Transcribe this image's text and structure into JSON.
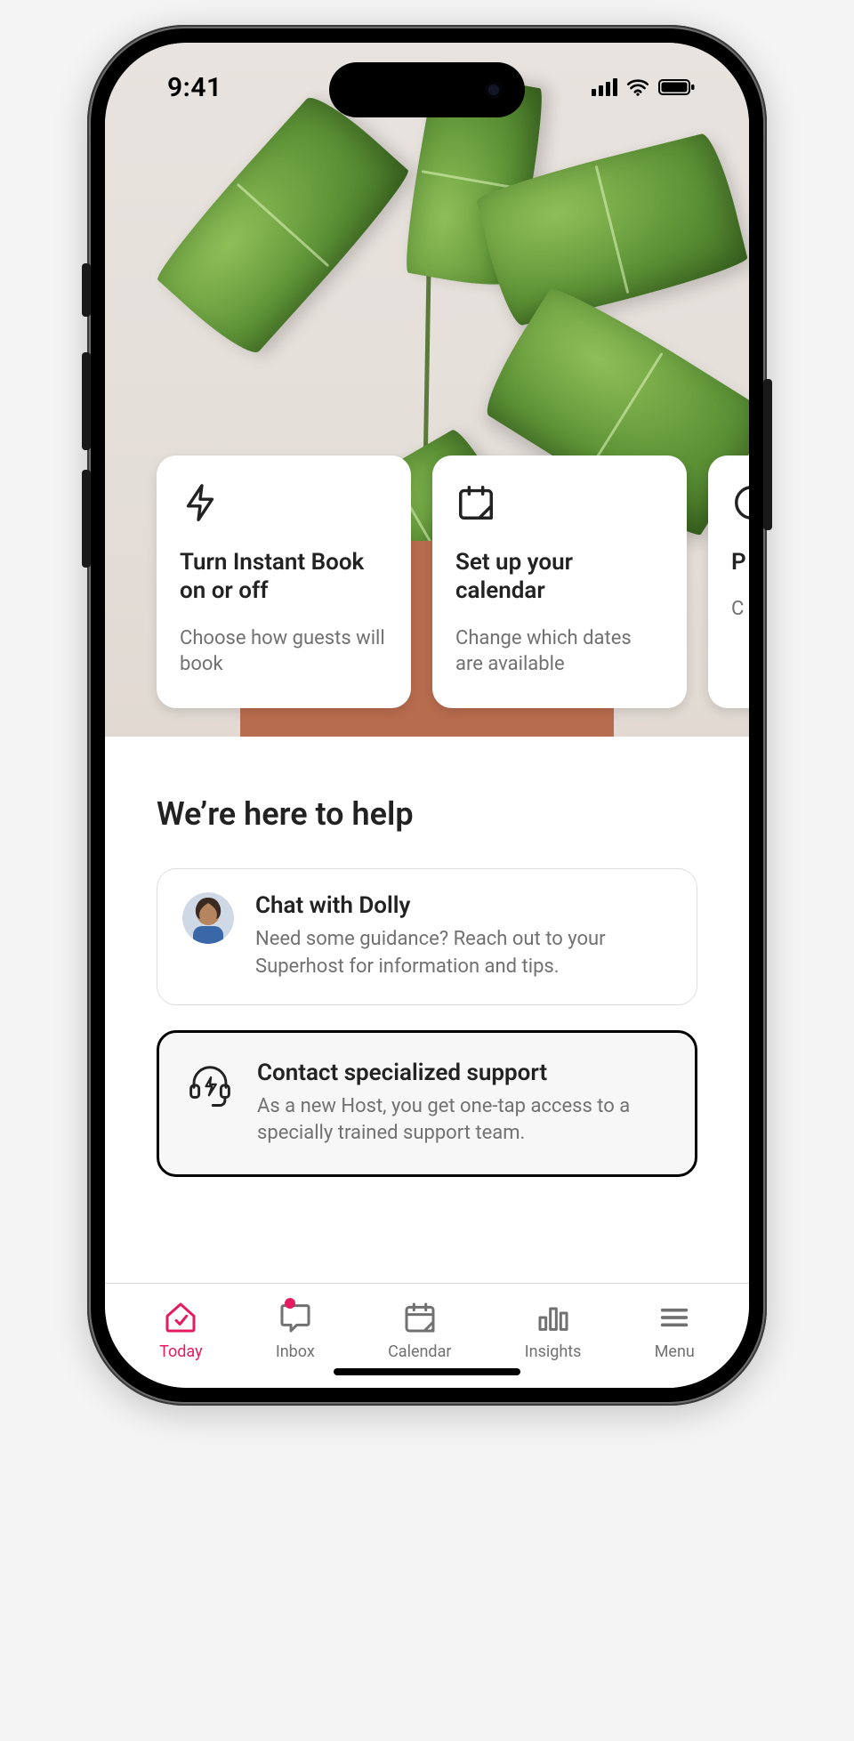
{
  "status": {
    "time": "9:41"
  },
  "cards": [
    {
      "title": "Turn Instant Book on or off",
      "sub": "Choose how guests will book"
    },
    {
      "title": "Set up your calendar",
      "sub": "Change which dates are available"
    },
    {
      "title_peek": "P",
      "sub_peek": "C"
    }
  ],
  "help": {
    "heading": "We’re here to help",
    "items": [
      {
        "title": "Chat with Dolly",
        "sub": "Need some guidance? Reach out to your Superhost for information and tips."
      },
      {
        "title": "Contact specialized support",
        "sub": "As a new Host, you get one-tap access to a specially trained support team."
      }
    ]
  },
  "tabs": {
    "today": "Today",
    "inbox": "Inbox",
    "calendar": "Calendar",
    "insights": "Insights",
    "menu": "Menu"
  }
}
